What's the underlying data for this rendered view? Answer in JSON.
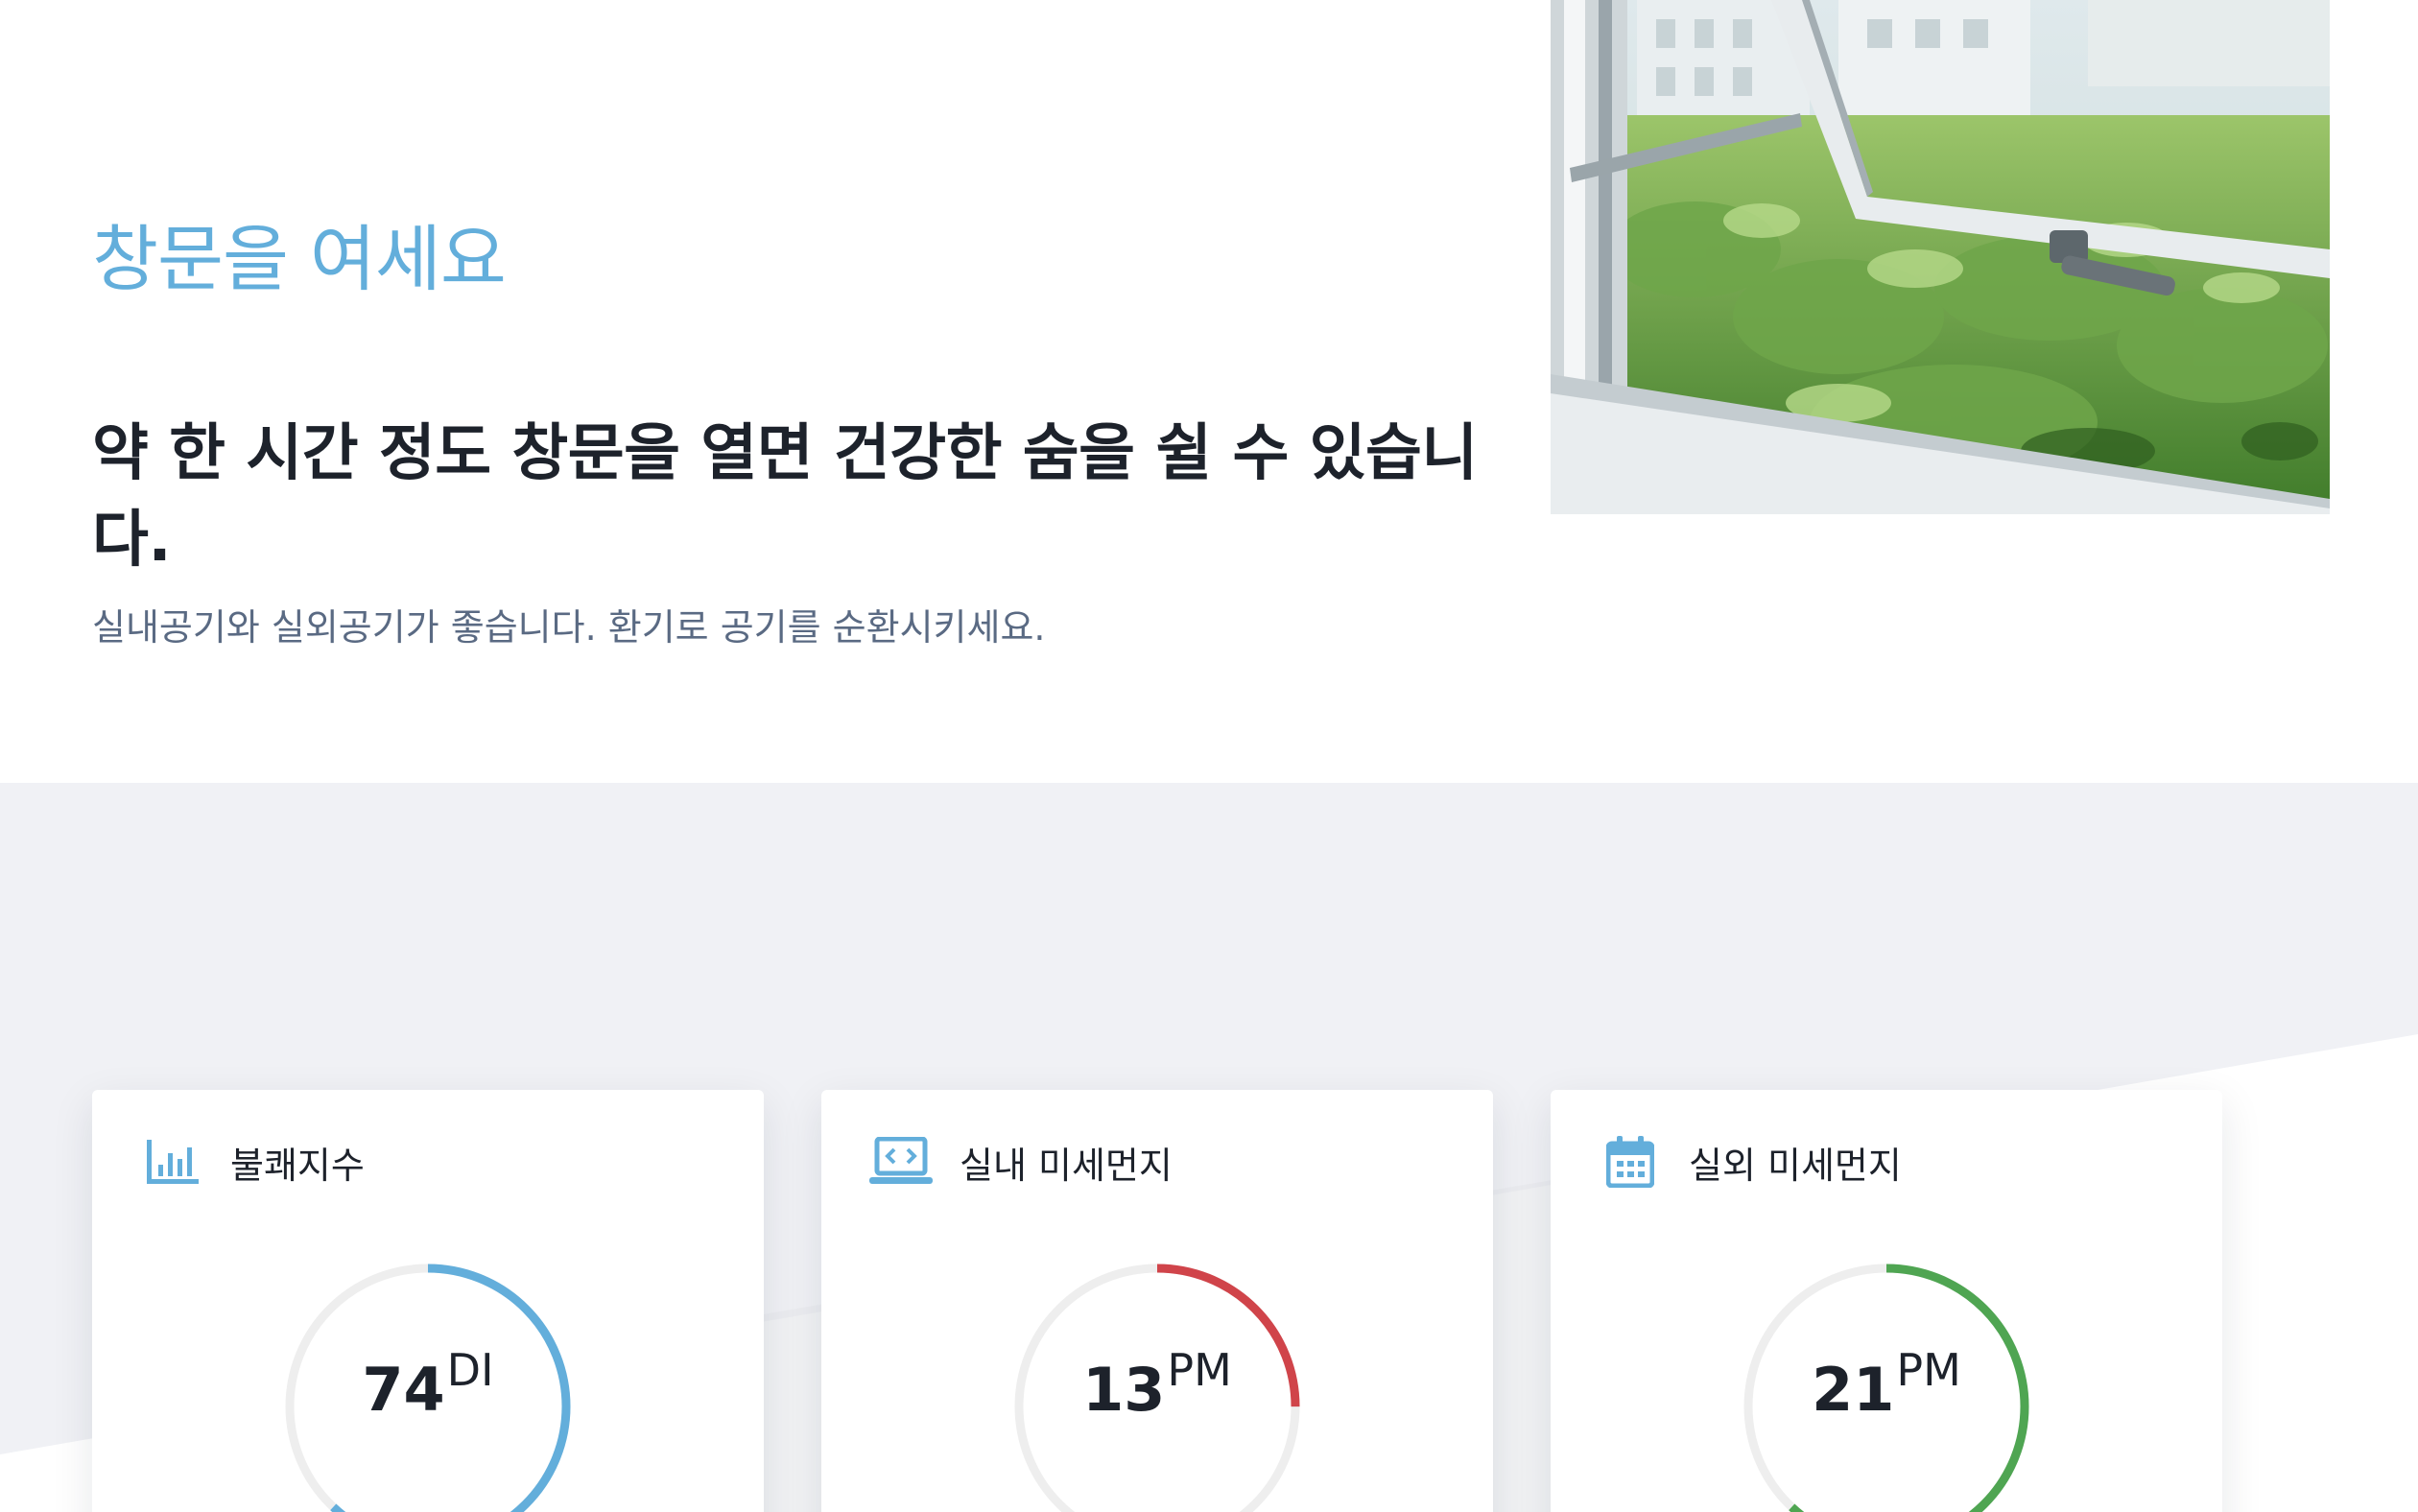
{
  "hero": {
    "eyebrow": "창문을 여세요",
    "heading": "약 한 시간 정도 창문을 열면 건강한 숨을 쉴 수 있습니다.",
    "subtext": "실내공기와 실외공기가 좋습니다. 환기로 공기를 순환시키세요."
  },
  "cards": [
    {
      "title": "불쾌지수",
      "value": "74",
      "unit": "DI",
      "icon": "bar-chart-icon",
      "color": "#63aedb",
      "gauge_fraction": 0.62
    },
    {
      "title": "실내 미세먼지",
      "value": "13",
      "unit": "PM",
      "icon": "laptop-code-icon",
      "color": "#d0444a",
      "gauge_fraction": 0.25
    },
    {
      "title": "실외 미세먼지",
      "value": "21",
      "unit": "PM",
      "icon": "calendar-icon",
      "color": "#4fa552",
      "gauge_fraction": 0.62
    }
  ],
  "colors": {
    "accent": "#63aedb",
    "heading": "#1d222b",
    "subtext": "#5a6a83",
    "section_bg": "#f0f1f5",
    "gauge_track": "#eeeeee"
  }
}
